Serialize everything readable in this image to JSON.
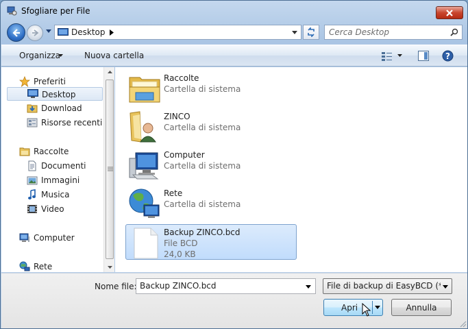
{
  "window": {
    "title": "Sfogliare per File"
  },
  "address_bar": {
    "location": "Desktop"
  },
  "search": {
    "placeholder": "Cerca Desktop"
  },
  "toolbar": {
    "organize_label": "Organizza",
    "new_folder_label": "Nuova cartella"
  },
  "nav_pane": {
    "items": [
      {
        "label": "Preferiti",
        "icon": "star-icon"
      },
      {
        "label": "Desktop",
        "icon": "desktop-icon",
        "selected": true
      },
      {
        "label": "Download",
        "icon": "download-folder-icon"
      },
      {
        "label": "Risorse recenti",
        "icon": "recent-places-icon"
      },
      {
        "label": "Raccolte",
        "icon": "libraries-icon"
      },
      {
        "label": "Documenti",
        "icon": "documents-icon"
      },
      {
        "label": "Immagini",
        "icon": "pictures-icon"
      },
      {
        "label": "Musica",
        "icon": "music-icon"
      },
      {
        "label": "Video",
        "icon": "video-icon"
      },
      {
        "label": "Computer",
        "icon": "computer-icon"
      },
      {
        "label": "Rete",
        "icon": "network-icon"
      }
    ]
  },
  "files": [
    {
      "name": "Raccolte",
      "type": "Cartella di sistema",
      "icon": "libraries-folder-icon"
    },
    {
      "name": "ZINCO",
      "type": "Cartella di sistema",
      "icon": "user-folder-icon"
    },
    {
      "name": "Computer",
      "type": "Cartella di sistema",
      "icon": "computer-icon"
    },
    {
      "name": "Rete",
      "type": "Cartella di sistema",
      "icon": "network-globe-icon"
    },
    {
      "name": "Backup ZINCO.bcd",
      "type": "File BCD",
      "size": "24,0 KB",
      "icon": "file-icon",
      "selected": true
    }
  ],
  "footer": {
    "filename_label": "Nome file:",
    "filename_value": "Backup ZINCO.bcd",
    "filetype_value": "File di backup di EasyBCD (*.bcd)",
    "open_label": "Apri",
    "cancel_label": "Annulla"
  },
  "colors": {
    "selection": "#c1dcfc",
    "close_button": "#c9462e",
    "accent": "#3c7fb1"
  }
}
